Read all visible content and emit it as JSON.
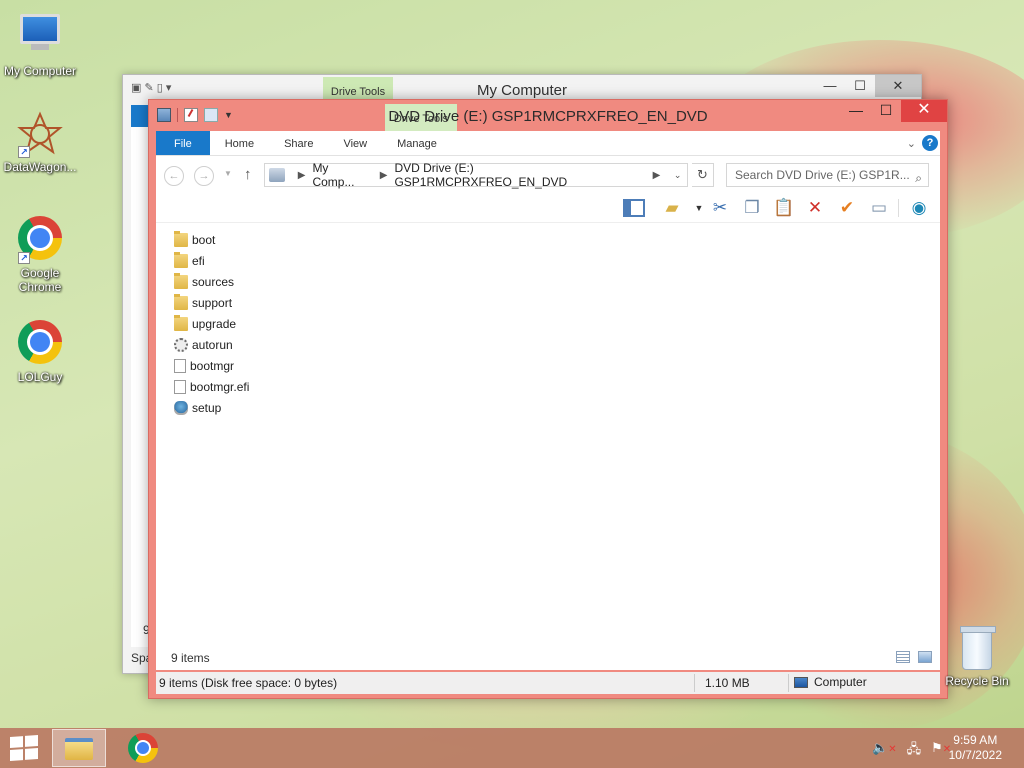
{
  "desktop": {
    "icons": [
      {
        "label": "My Computer"
      },
      {
        "label": "DataWagon..."
      },
      {
        "label": "Google Chrome"
      },
      {
        "label": "LOLGuy"
      }
    ],
    "recycle_bin": "Recycle Bin"
  },
  "back_window": {
    "title": "My Computer",
    "context_tab": "Drive Tools",
    "footer_text": "Spa",
    "footer_count": "9"
  },
  "window": {
    "title": "DVD Drive (E:) GSP1RMCPRXFREO_EN_DVD",
    "context_tab": "Drive Tools",
    "tabs": [
      "File",
      "Home",
      "Share",
      "View",
      "Manage"
    ],
    "address": {
      "crumbs": [
        "My Comp...",
        "DVD Drive (E:) GSP1RMCPRXFREO_EN_DVD"
      ]
    },
    "search": {
      "placeholder": "Search DVD Drive (E:) GSP1R..."
    },
    "files": [
      {
        "name": "boot",
        "type": "folder"
      },
      {
        "name": "efi",
        "type": "folder"
      },
      {
        "name": "sources",
        "type": "folder"
      },
      {
        "name": "support",
        "type": "folder"
      },
      {
        "name": "upgrade",
        "type": "folder"
      },
      {
        "name": "autorun",
        "type": "settings"
      },
      {
        "name": "bootmgr",
        "type": "file"
      },
      {
        "name": "bootmgr.efi",
        "type": "file"
      },
      {
        "name": "setup",
        "type": "setup"
      }
    ],
    "items_count": "9 items",
    "status": {
      "summary": "9 items (Disk free space: 0 bytes)",
      "size": "1.10 MB",
      "location": "Computer"
    }
  },
  "taskbar": {
    "time": "9:59 AM",
    "date": "10/7/2022"
  },
  "colors": {
    "window_frame": "#f08a80",
    "accent": "#1979ca",
    "drive_tools": "#d3ebc0",
    "close": "#e04343"
  }
}
